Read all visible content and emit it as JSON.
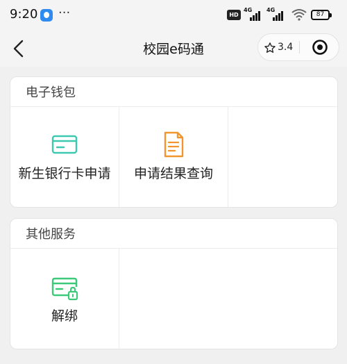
{
  "status_bar": {
    "time": "9:20",
    "dots": "···",
    "hd": "HD",
    "network_1": "4G",
    "network_2": "4G",
    "battery": "87"
  },
  "nav": {
    "title": "校园e码通",
    "rating": "3.4"
  },
  "sections": [
    {
      "title": "电子钱包",
      "items": [
        {
          "label": "新生银行卡申请",
          "icon": "bank-card-icon",
          "color": "#3cc9b0"
        },
        {
          "label": "申请结果查询",
          "icon": "document-icon",
          "color": "#f0962c"
        }
      ]
    },
    {
      "title": "其他服务",
      "items": [
        {
          "label": "解绑",
          "icon": "card-lock-icon",
          "color": "#3cc97a"
        }
      ]
    }
  ]
}
